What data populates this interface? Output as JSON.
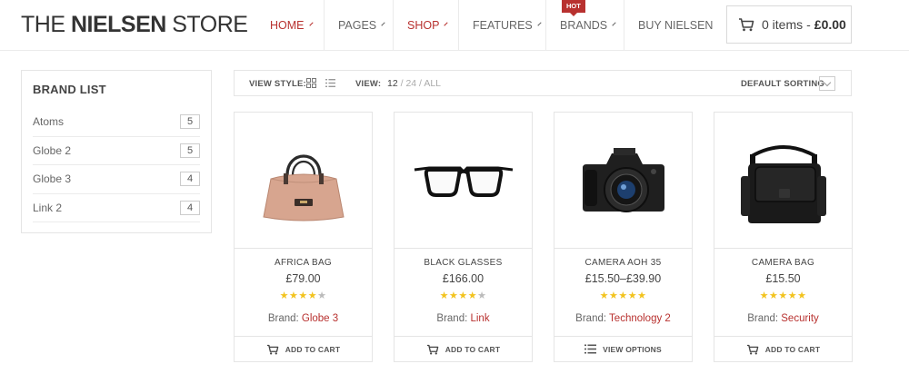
{
  "brand": {
    "logo_light": "THE ",
    "logo_bold": "NIELSEN",
    "logo_rest": " STORE"
  },
  "nav": {
    "home": "HOME",
    "pages": "PAGES",
    "shop": "SHOP",
    "features": "FEATURES",
    "brands": "BRANDS",
    "hot_badge": "HOT",
    "buy": "BUY NIELSEN"
  },
  "cart": {
    "items": "0 items",
    "separator": "-",
    "total": "£0.00"
  },
  "sidebar": {
    "title": "BRAND LIST",
    "items": [
      {
        "label": "Atoms",
        "count": "5"
      },
      {
        "label": "Globe 2",
        "count": "5"
      },
      {
        "label": "Globe 3",
        "count": "4"
      },
      {
        "label": "Link 2",
        "count": "4"
      }
    ]
  },
  "toolbar": {
    "view_style_label": "VIEW STYLE:",
    "view_label": "VIEW:",
    "count_12": "12",
    "sep1": " / ",
    "count_24": "24",
    "sep2": " / ",
    "count_all": "ALL",
    "sort_label": "DEFAULT SORTING"
  },
  "products": [
    {
      "name": "AFRICA BAG",
      "price": "£79.00",
      "rating": 4,
      "brand_prefix": "Brand: ",
      "brand": "Globe 3",
      "action": "ADD TO CART"
    },
    {
      "name": "BLACK GLASSES",
      "price": "£166.00",
      "rating": 4,
      "brand_prefix": "Brand: ",
      "brand": "Link",
      "action": "ADD TO CART"
    },
    {
      "name": "CAMERA AOH 35",
      "price": "£15.50–£39.90",
      "rating": 5,
      "brand_prefix": "Brand: ",
      "brand": "Technology 2",
      "action": "VIEW OPTIONS"
    },
    {
      "name": "CAMERA BAG",
      "price": "£15.50",
      "rating": 5,
      "brand_prefix": "Brand: ",
      "brand": "Security",
      "action": "ADD TO CART"
    }
  ],
  "colors": {
    "accent": "#b8312f",
    "star": "#f2c31e",
    "border": "#e5e5e5"
  },
  "icons": {
    "cart": "cart-icon",
    "grid": "grid-view-icon",
    "list": "list-view-icon",
    "options": "list-options-icon",
    "chevron": "chevron-down-icon"
  }
}
